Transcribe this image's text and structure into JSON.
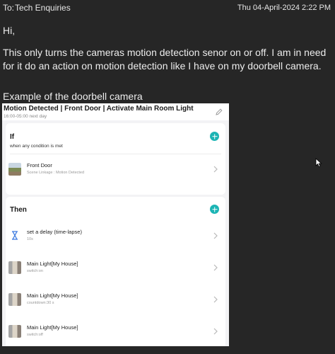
{
  "header": {
    "to_label": "To:",
    "to_name": "Tech Enquiries",
    "date": "Thu 04-April-2024 2:22 PM"
  },
  "message": {
    "greeting": "Hi,",
    "paragraph": "This only turns the cameras motion detection senor on or off. I am in need for it do an action on motion detection like I have on my doorbell camera.",
    "example_label": "Example of the doorbell camera"
  },
  "screenshot": {
    "title": "Motion Detected | Front Door | Activate Main Room Light",
    "schedule": "16:00-05:00 next day",
    "if_card": {
      "heading": "If",
      "condition": "when any condition is met",
      "rows": [
        {
          "title": "Front Door",
          "subtitle": "Scene Linkage : Motion Detected",
          "icon": "camera-thumbnail"
        }
      ]
    },
    "then_card": {
      "heading": "Then",
      "rows": [
        {
          "title": "set a delay (time-lapse)",
          "subtitle": "10s",
          "icon": "hourglass-icon"
        },
        {
          "title": "Main Light[My House]",
          "subtitle": "switch:on",
          "icon": "light-thumbnail"
        },
        {
          "title": "Main Light[My House]",
          "subtitle": "countdown:30 s",
          "icon": "light-thumbnail"
        },
        {
          "title": "Main Light[My House]",
          "subtitle": "switch:off",
          "icon": "light-thumbnail"
        }
      ]
    },
    "colors": {
      "accent": "#1bb4b4",
      "hourglass": "#3d7be0"
    }
  }
}
